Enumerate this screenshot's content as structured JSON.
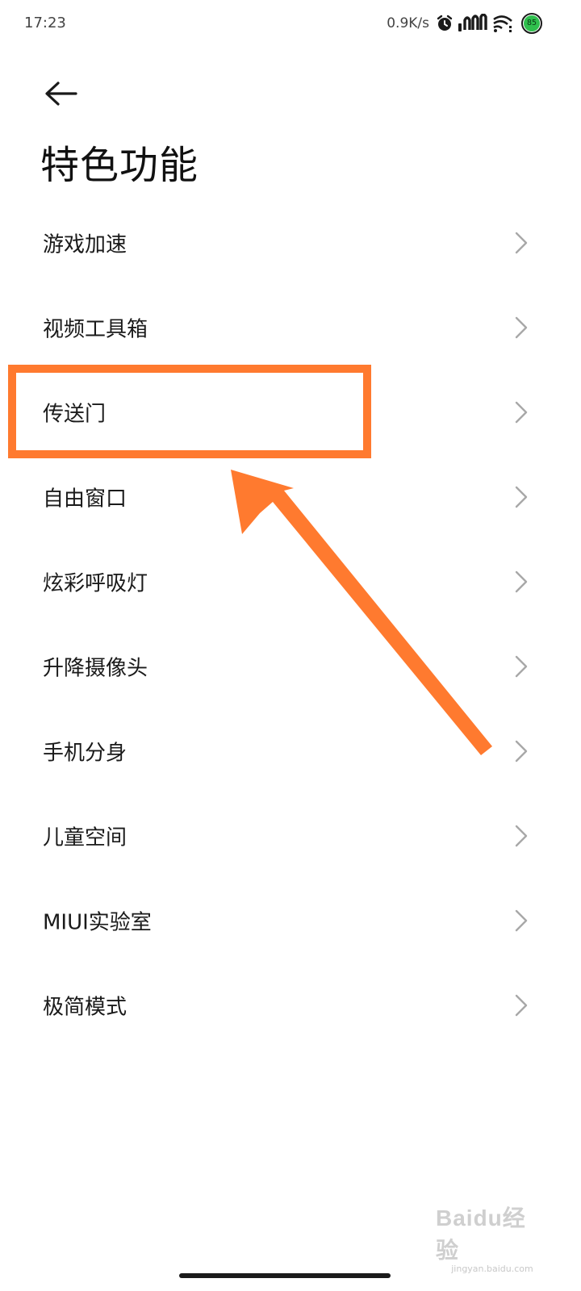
{
  "status_bar": {
    "time": "17:23",
    "network_speed": "0.9K/s",
    "icons": [
      "alarm-icon",
      "cellular-signal-icon",
      "wifi-icon",
      "battery-icon"
    ],
    "battery_level": "85",
    "battery_color": "#2fbf4d"
  },
  "header": {
    "back_icon": "arrow-left-icon",
    "title": "特色功能"
  },
  "list": {
    "items": [
      {
        "label": "游戏加速"
      },
      {
        "label": "视频工具箱"
      },
      {
        "label": "传送门"
      },
      {
        "label": "自由窗口"
      },
      {
        "label": "炫彩呼吸灯"
      },
      {
        "label": "升降摄像头"
      },
      {
        "label": "手机分身"
      },
      {
        "label": "儿童空间"
      },
      {
        "label": "MIUI实验室"
      },
      {
        "label": "极简模式"
      }
    ],
    "chevron_icon": "chevron-right-icon"
  },
  "annotation": {
    "highlighted_item": "传送门",
    "color": "#ff7a2f"
  },
  "watermark": {
    "logo": "Baidu经验",
    "sub": "jingyan.baidu.com"
  }
}
